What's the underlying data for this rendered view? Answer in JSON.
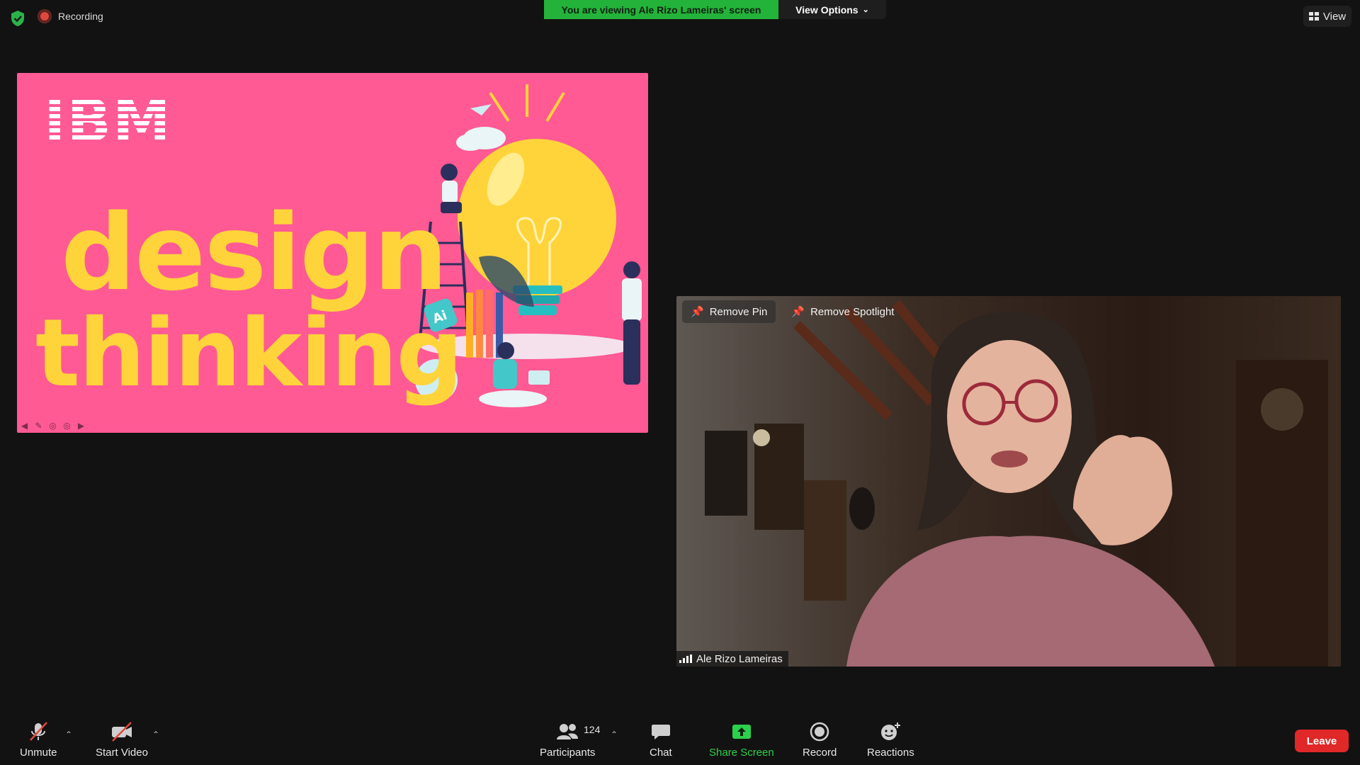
{
  "top_bar": {
    "recording_label": "Recording",
    "viewing_banner": "You are viewing Ale Rizo Lameiras' screen",
    "view_options_label": "View Options",
    "view_label": "View",
    "banner_color": "#23b33a"
  },
  "shared_slide": {
    "logo_text": "IBM",
    "title_line1": "design",
    "title_line2": "thinking",
    "background_color": "#ff5a93",
    "text_color": "#ffd43b",
    "controls": [
      "arrow-left-icon",
      "pen-icon",
      "circle-icon",
      "circle-icon",
      "arrow-right-icon"
    ]
  },
  "video": {
    "remove_pin_label": "Remove Pin",
    "remove_spotlight_label": "Remove Spotlight",
    "participant_name": "Ale Rizo Lameiras"
  },
  "toolbar": {
    "unmute_label": "Unmute",
    "start_video_label": "Start Video",
    "participants_label": "Participants",
    "participants_count": "124",
    "chat_label": "Chat",
    "share_screen_label": "Share Screen",
    "record_label": "Record",
    "reactions_label": "Reactions",
    "leave_label": "Leave",
    "share_color": "#2dd04a",
    "leave_color": "#e02828"
  }
}
